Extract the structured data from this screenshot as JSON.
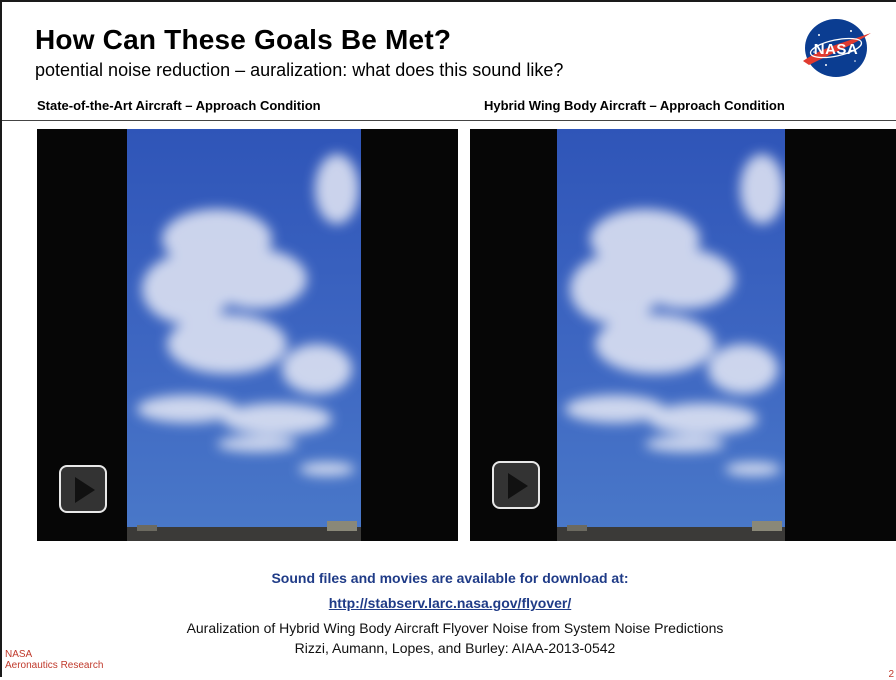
{
  "slide": {
    "title": "How Can These Goals Be Met?",
    "subtitle": "potential noise reduction – auralization: what does this sound like?",
    "logo_text": "NASA"
  },
  "videos": [
    {
      "heading": "State-of-the-Art Aircraft – Approach Condition",
      "control": "play-button"
    },
    {
      "heading": "Hybrid Wing Body Aircraft – Approach Condition",
      "control": "play-button"
    }
  ],
  "download": {
    "text": "Sound files and movies are available for download at:",
    "link": "http://stabserv.larc.nasa.gov/flyover/"
  },
  "citation": {
    "line1": "Auralization of Hybrid Wing Body Aircraft Flyover Noise from System Noise Predictions",
    "line2": "Rizzi, Aumann, Lopes, and Burley: AIAA-2013-0542"
  },
  "footer": {
    "org_line1": "NASA",
    "org_line2": "Aeronautics Research",
    "page_number": "2"
  },
  "colors": {
    "link_blue": "#1f3b87",
    "footer_red": "#c0392b",
    "sky_top": "#2f55b8",
    "sky_bottom": "#4a79c9"
  }
}
